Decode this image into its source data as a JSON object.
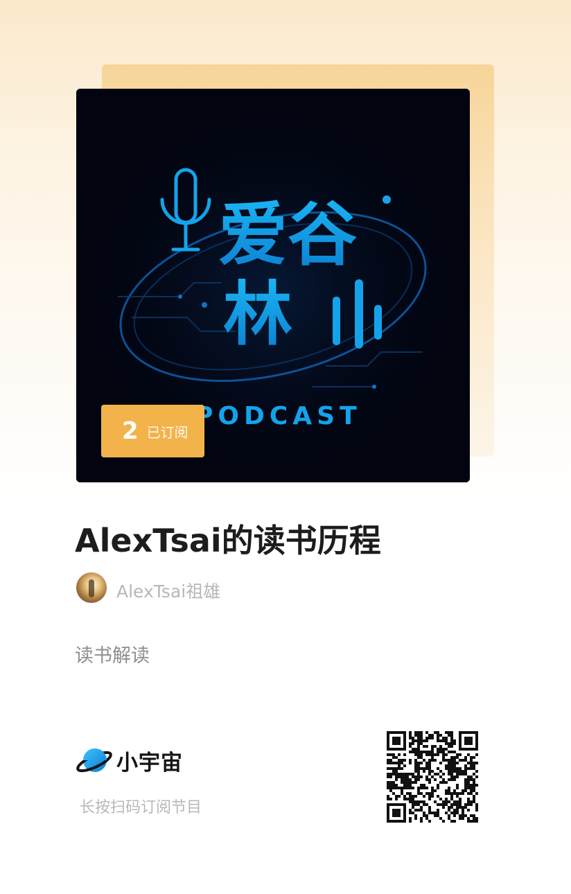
{
  "podcast": {
    "title": "AlexTsai的读书历程",
    "author": "AlexTsai祖雄",
    "category": "读书解读",
    "subscribers": {
      "count": "2",
      "label": "已订阅"
    },
    "cover": {
      "title_line1": "爱谷",
      "title_line2": "林",
      "subtitle": "PODCAST",
      "accent_color": "#14a3ea",
      "background_color": "#02040f",
      "icon": "microphone-icon"
    }
  },
  "footer": {
    "brand_name": "小宇宙",
    "brand_icon": "planet-icon",
    "hint": "长按扫码订阅节目",
    "qr_icon": "qr-code"
  }
}
